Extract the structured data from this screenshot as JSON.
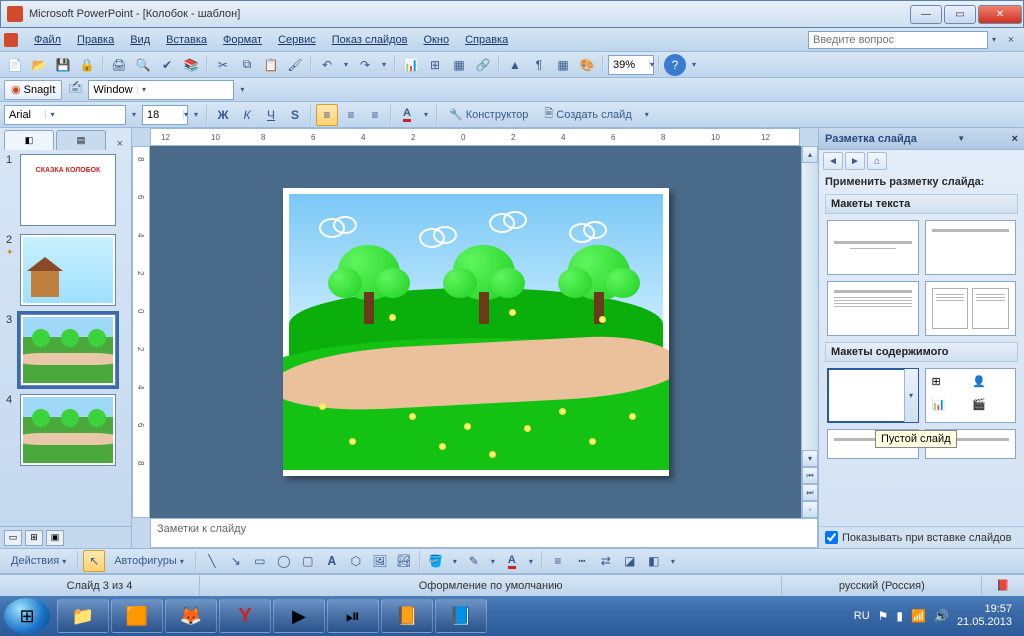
{
  "titlebar": {
    "title": "Microsoft PowerPoint - [Колобок - шаблон]"
  },
  "menu": {
    "items": [
      "Файл",
      "Правка",
      "Вид",
      "Вставка",
      "Формат",
      "Сервис",
      "Показ слайдов",
      "Окно",
      "Справка"
    ],
    "question_placeholder": "Введите вопрос"
  },
  "toolbar1": {
    "zoom": "39%"
  },
  "snagit": {
    "label": "SnagIt",
    "window_label": "Window"
  },
  "format_toolbar": {
    "font": "Arial",
    "size": "18",
    "bold": "Ж",
    "italic": "К",
    "underline": "Ч",
    "shadow": "S",
    "designer_label": "Конструктор",
    "new_slide_label": "Создать слайд"
  },
  "thumbnails": {
    "tabs": [
      "◧",
      "▤"
    ],
    "slides": [
      {
        "num": "1",
        "starred": false
      },
      {
        "num": "2",
        "starred": true
      },
      {
        "num": "3",
        "starred": false,
        "selected": true
      },
      {
        "num": "4",
        "starred": false
      }
    ],
    "slide1_title": "СКАЗКА КОЛОБОК"
  },
  "ruler_h_labels": [
    "12",
    "10",
    "8",
    "6",
    "4",
    "2",
    "0",
    "2",
    "4",
    "6",
    "8",
    "10",
    "12"
  ],
  "ruler_v_labels": [
    "8",
    "6",
    "4",
    "2",
    "0",
    "2",
    "4",
    "6",
    "8"
  ],
  "notes_placeholder": "Заметки к слайду",
  "taskpane": {
    "title": "Разметка слайда",
    "apply_label": "Применить разметку слайда:",
    "section_text": "Макеты текста",
    "section_content": "Макеты содержимого",
    "tooltip": "Пустой слайд",
    "show_on_insert": "Показывать при вставке слайдов"
  },
  "drawing": {
    "actions_label": "Действия",
    "autoshapes_label": "Автофигуры"
  },
  "statusbar": {
    "slide": "Слайд 3 из 4",
    "design": "Оформление по умолчанию",
    "lang": "русский (Россия)"
  },
  "tray": {
    "lang": "RU",
    "time": "19:57",
    "date": "21.05.2013"
  }
}
